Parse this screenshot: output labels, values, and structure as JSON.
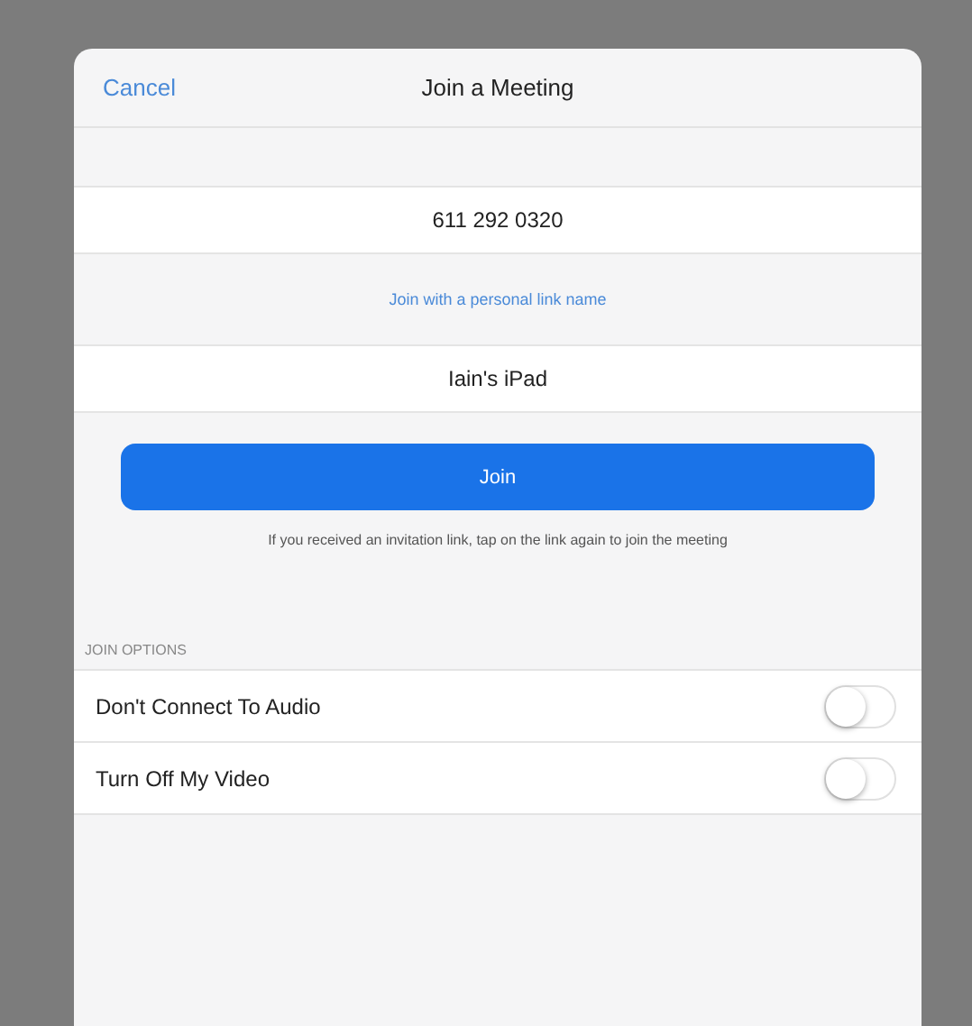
{
  "header": {
    "cancel": "Cancel",
    "title": "Join a Meeting"
  },
  "meeting_id": {
    "value": "611 292 0320"
  },
  "personal_link": "Join with a personal link name",
  "display_name": {
    "value": "Iain's iPad"
  },
  "join_button": "Join",
  "hint": "If you received an invitation link, tap on the link again to join the meeting",
  "options_header": "JOIN OPTIONS",
  "options": [
    {
      "label": "Don't Connect To Audio",
      "on": false
    },
    {
      "label": "Turn Off My Video",
      "on": false
    }
  ]
}
